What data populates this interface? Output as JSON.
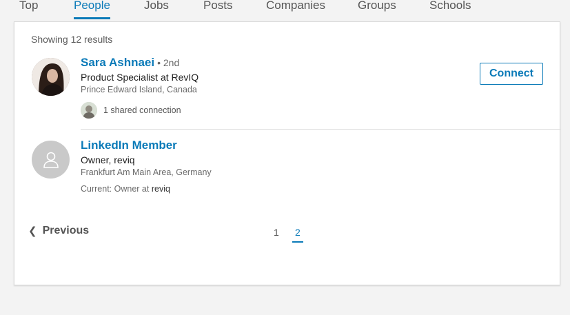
{
  "tabs": [
    {
      "label": "Top",
      "active": false
    },
    {
      "label": "People",
      "active": true
    },
    {
      "label": "Jobs",
      "active": false
    },
    {
      "label": "Posts",
      "active": false
    },
    {
      "label": "Companies",
      "active": false
    },
    {
      "label": "Groups",
      "active": false
    },
    {
      "label": "Schools",
      "active": false
    }
  ],
  "results": {
    "count_text": "Showing 12 results",
    "items": [
      {
        "name": "Sara Ashnaei",
        "degree": "• 2nd",
        "headline": "Product Specialist at RevIQ",
        "location": "Prince Edward Island, Canada",
        "shared_connections": "1 shared connection",
        "action_label": "Connect",
        "avatar": "profile-photo"
      },
      {
        "name": "LinkedIn Member",
        "headline": "Owner, reviq",
        "location": "Frankfurt Am Main Area, Germany",
        "current_prefix": "Current: Owner at",
        "current_company": "reviq",
        "avatar": "person-placeholder-icon"
      }
    ]
  },
  "pagination": {
    "previous_label": "Previous",
    "previous_icon": "chevron-left-icon",
    "pages": [
      "1",
      "2"
    ],
    "current_page": "2"
  },
  "colors": {
    "accent": "#0a7ab8",
    "background": "#f3f3f3",
    "card": "#ffffff"
  }
}
